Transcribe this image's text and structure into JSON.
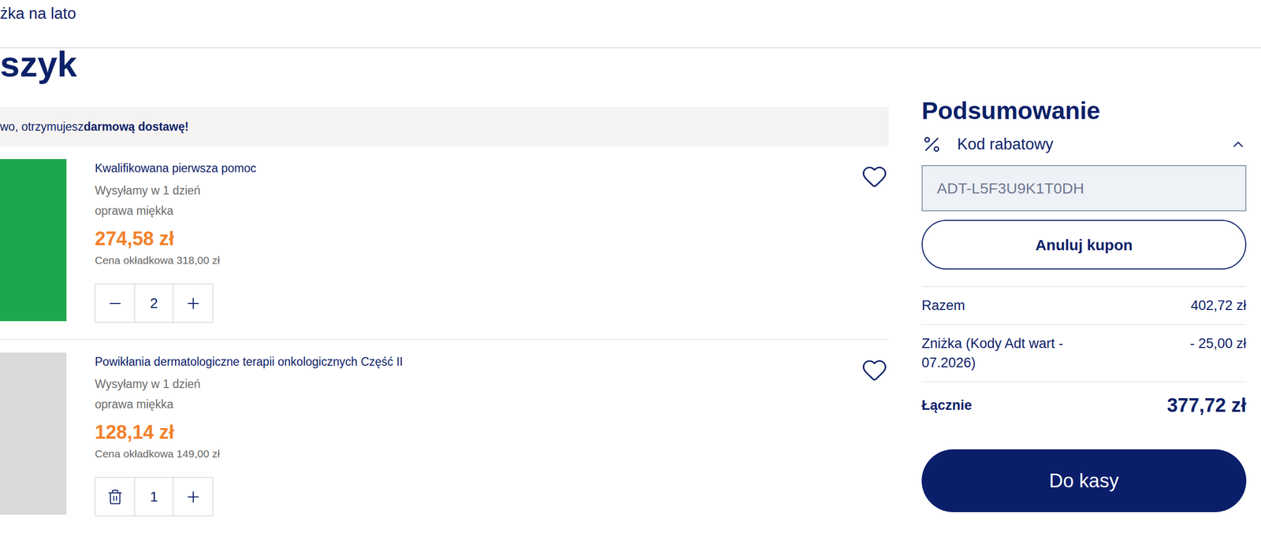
{
  "header": {
    "breadcrumb": "żka na lato"
  },
  "page_title": "szyk",
  "banner": {
    "text": "wo, otrzymujesz ",
    "bold": "darmową dostawę!"
  },
  "items": [
    {
      "title": "Kwalifikowana pierwsza pomoc",
      "shipping": "Wysyłamy w 1 dzień",
      "binding": "oprawa miękka",
      "price": "274,58 zł",
      "cover_price": "Cena okładkowa 318,00 zł",
      "quantity": "2",
      "favorite": false,
      "decrease_kind": "minus",
      "color": "#1ea64e"
    },
    {
      "title": "Powikłania dermatologiczne terapii onkologicznych Część II",
      "shipping": "Wysyłamy w 1 dzień",
      "binding": "oprawa miękka",
      "price": "128,14 zł",
      "cover_price": "Cena okładkowa 149,00 zł",
      "quantity": "1",
      "favorite": false,
      "decrease_kind": "trash",
      "color": "#d9d9d9"
    }
  ],
  "summary": {
    "title": "Podsumowanie",
    "coupon": {
      "label": "Kod rabatowy",
      "expanded": true,
      "code": "ADT-L5F3U9K1T0DH",
      "button": "Anuluj kupon"
    },
    "rows": [
      {
        "label": "Razem",
        "value": "402,72 zł"
      },
      {
        "label": "Zniżka (Kody Adt wart - 07.2026)",
        "value": "- 25,00 zł"
      }
    ],
    "total": {
      "label": "Łącznie",
      "value": "377,72 zł"
    },
    "checkout": "Do kasy"
  }
}
